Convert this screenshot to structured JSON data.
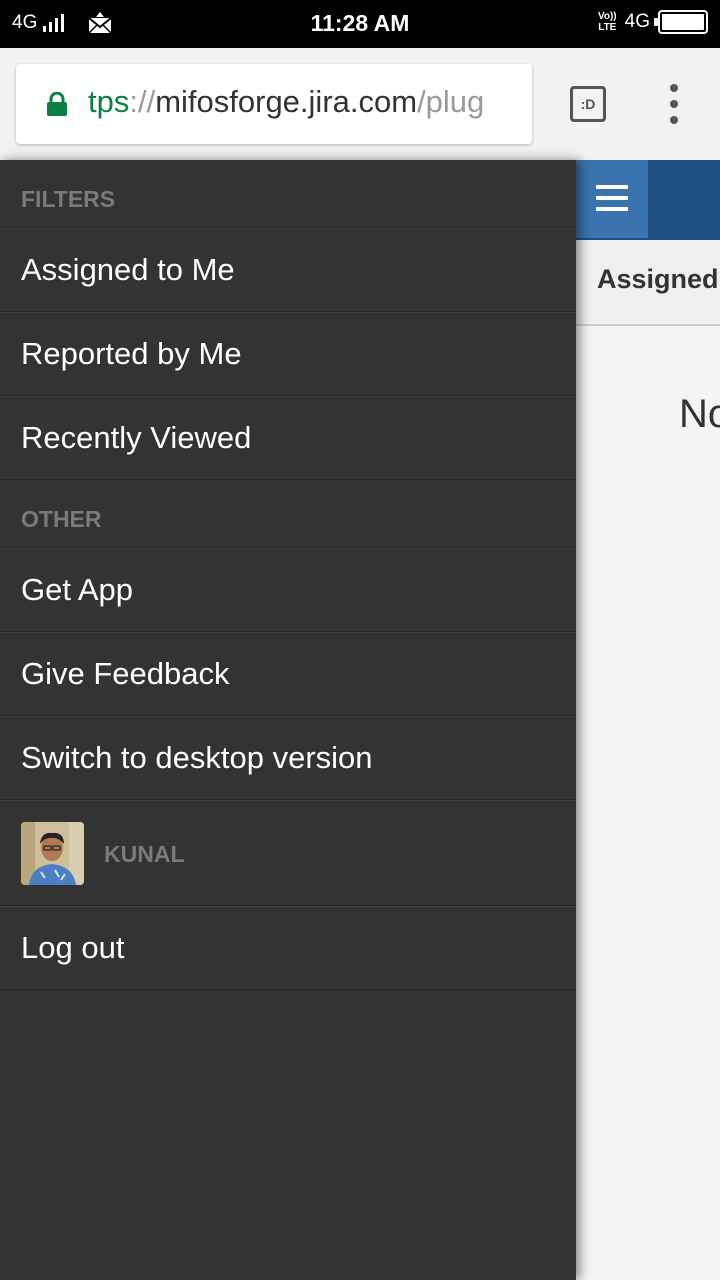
{
  "status_bar": {
    "network_left": "4G",
    "time": "11:28 AM",
    "volte_line1": "Vo))",
    "volte_line2": "LTE",
    "network_right": "4G"
  },
  "browser": {
    "url_scheme": "tps",
    "url_separator": "://",
    "url_host": "mifosforge.jira.com",
    "url_path": "/plug",
    "tab_button_label": ":D"
  },
  "drawer": {
    "filters_heading": "FILTERS",
    "filters": [
      {
        "label": "Assigned to Me"
      },
      {
        "label": "Reported by Me"
      },
      {
        "label": "Recently Viewed"
      }
    ],
    "other_heading": "OTHER",
    "other": [
      {
        "label": "Get App"
      },
      {
        "label": "Give Feedback"
      },
      {
        "label": "Switch to desktop version"
      }
    ],
    "user_name": "KUNAL",
    "logout_label": "Log out"
  },
  "page": {
    "filter_title": "Assigned t",
    "empty_text": "No"
  },
  "colors": {
    "drawer_bg": "#333333",
    "header_blue": "#205081",
    "hamburger_blue": "#3b73af",
    "url_green": "#0b8043"
  }
}
